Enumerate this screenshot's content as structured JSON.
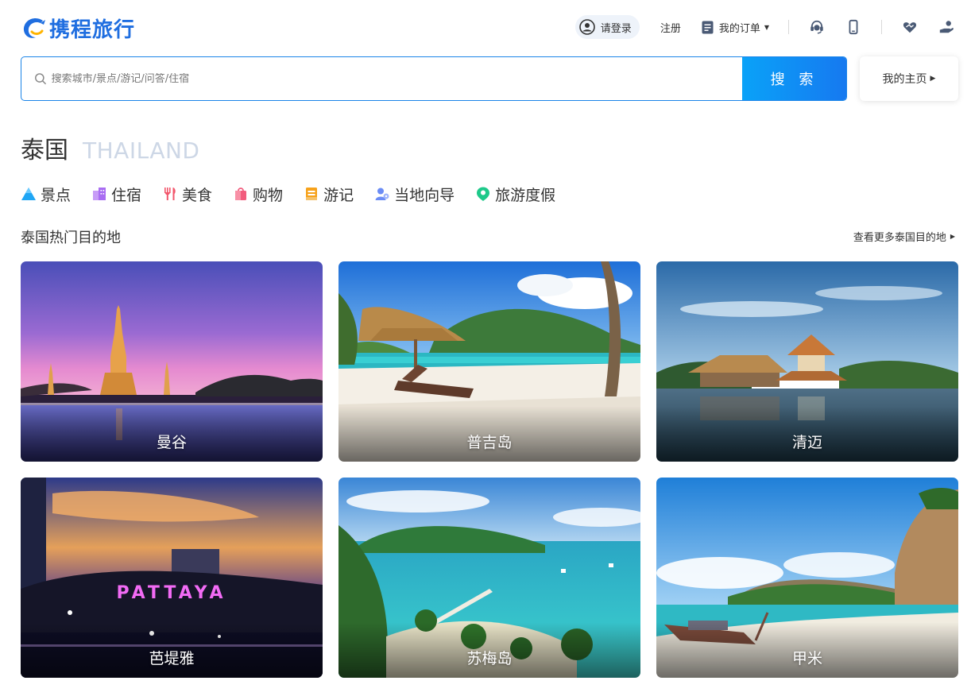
{
  "header": {
    "logo_text": "携程旅行",
    "login_label": "请登录",
    "register_label": "注册",
    "orders_label": "我的订单",
    "icons": [
      "customer-service-icon",
      "mobile-app-icon",
      "charity-heart-icon",
      "user-service-icon"
    ]
  },
  "search": {
    "placeholder": "搜索城市/景点/游记/问答/住宿",
    "button_label": "搜 索"
  },
  "home_button_label": "我的主页",
  "country": {
    "name_cn": "泰国",
    "name_en": "THAILAND"
  },
  "categories": [
    {
      "label": "景点",
      "icon": "attraction-icon",
      "color": "#1fa6f5"
    },
    {
      "label": "住宿",
      "icon": "hotel-icon",
      "color": "#a96df2"
    },
    {
      "label": "美食",
      "icon": "food-icon",
      "color": "#f2566b"
    },
    {
      "label": "购物",
      "icon": "shopping-icon",
      "color": "#f25c7d"
    },
    {
      "label": "游记",
      "icon": "travelogue-icon",
      "color": "#f7a21b"
    },
    {
      "label": "当地向导",
      "icon": "local-guide-icon",
      "color": "#6b8cf5"
    },
    {
      "label": "旅游度假",
      "icon": "vacation-icon",
      "color": "#1ec98a"
    }
  ],
  "destinations_section": {
    "title": "泰国热门目的地",
    "more_link": "查看更多泰国目的地"
  },
  "destinations": [
    {
      "name": "曼谷"
    },
    {
      "name": "普吉岛"
    },
    {
      "name": "清迈"
    },
    {
      "name": "芭堤雅",
      "sign_text": "PATTAYA"
    },
    {
      "name": "苏梅岛"
    },
    {
      "name": "甲米"
    }
  ],
  "colors": {
    "brand": "#1f6ee0",
    "search_button": "#1679f0",
    "english_title": "#cdd7e6"
  }
}
